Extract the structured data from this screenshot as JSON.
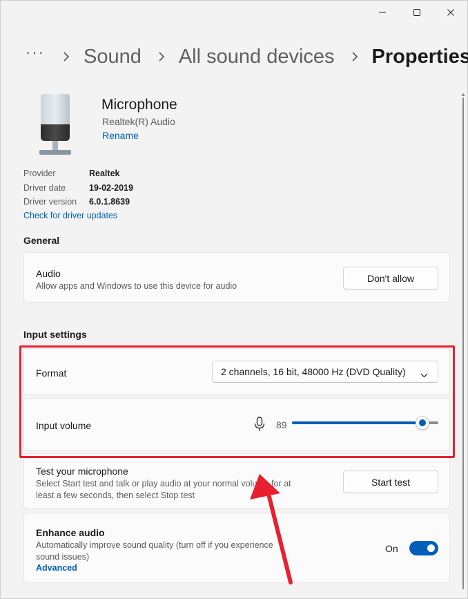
{
  "window": {
    "controls": {
      "minimize": "minimize-icon",
      "maximize": "maximize-icon",
      "close": "close-icon"
    }
  },
  "breadcrumb": {
    "more": "···",
    "items": [
      "Sound",
      "All sound devices"
    ],
    "current": "Properties"
  },
  "device": {
    "name": "Microphone",
    "driver_name": "Realtek(R) Audio",
    "rename_label": "Rename",
    "icon": "microphone-device-icon"
  },
  "properties": {
    "provider_label": "Provider",
    "provider_value": "Realtek",
    "date_label": "Driver date",
    "date_value": "19-02-2019",
    "version_label": "Driver version",
    "version_value": "6.0.1.8639",
    "update_link": "Check for driver updates"
  },
  "general": {
    "title": "General",
    "audio": {
      "title": "Audio",
      "desc": "Allow apps and Windows to use this device for audio",
      "button": "Don't allow"
    }
  },
  "input_settings": {
    "title": "Input settings",
    "format": {
      "label": "Format",
      "selected": "2 channels, 16 bit, 48000 Hz (DVD Quality)"
    },
    "volume": {
      "label": "Input volume",
      "value": "89",
      "level": 0.89
    },
    "test": {
      "title": "Test your microphone",
      "desc_line1": "Select Start test and talk or play audio at your normal volume for at",
      "desc_line2": "least a few seconds, then select Stop test",
      "button": "Start test"
    },
    "enhance": {
      "title": "Enhance audio",
      "desc_line1": "Automatically improve sound quality (turn off if you experience",
      "desc_line2": "sound issues)",
      "link": "Advanced",
      "state_label": "On",
      "enabled": true
    }
  },
  "colors": {
    "accent": "#005fb8",
    "annotation": "#e8202e",
    "background": "#f3f3f3"
  }
}
